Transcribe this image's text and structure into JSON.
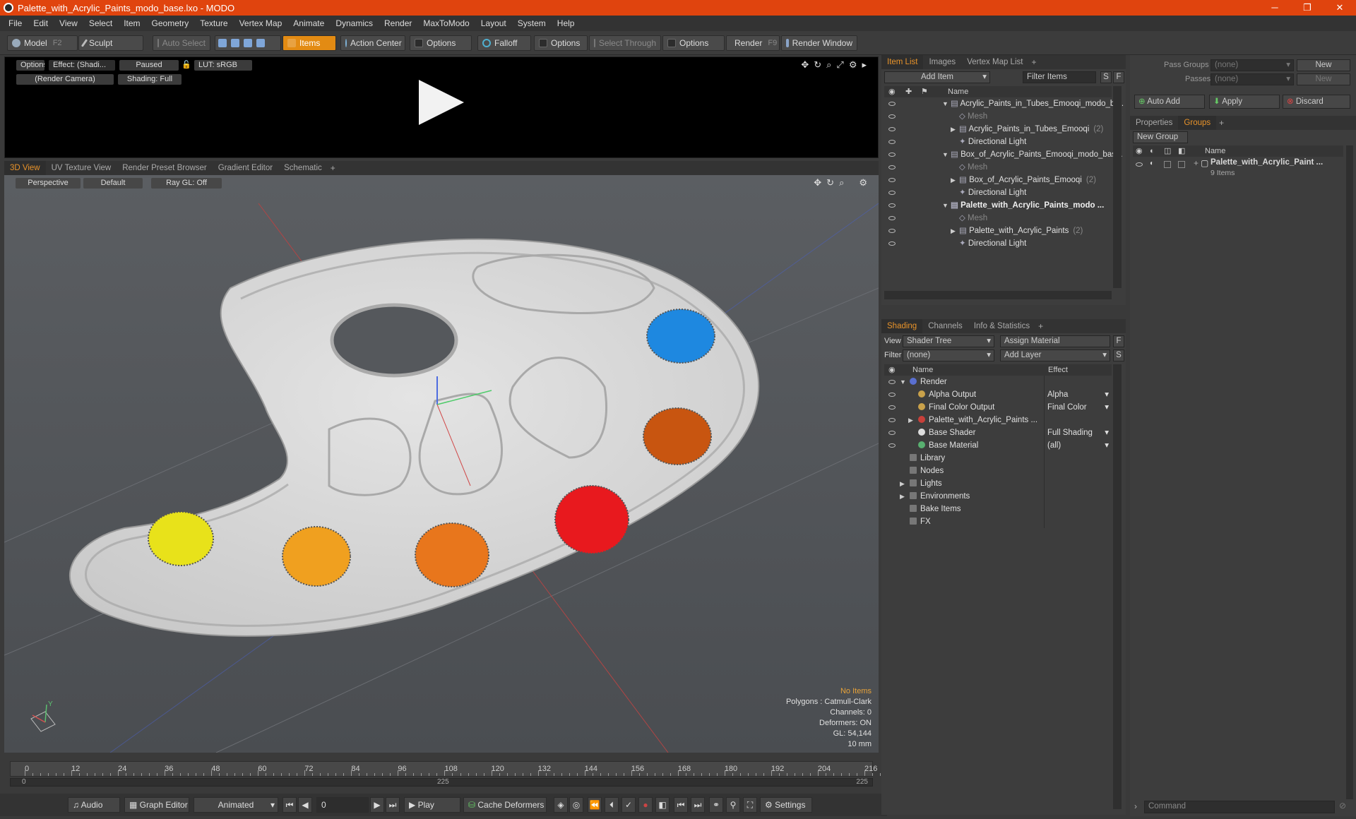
{
  "window": {
    "title": "Palette_with_Acrylic_Paints_modo_base.lxo - MODO",
    "minimize": "─",
    "maximize": "❐",
    "close": "✕"
  },
  "menu": [
    "File",
    "Edit",
    "View",
    "Select",
    "Item",
    "Geometry",
    "Texture",
    "Vertex Map",
    "Animate",
    "Dynamics",
    "Render",
    "MaxToModo",
    "Layout",
    "System",
    "Help"
  ],
  "toolbar": {
    "model": "Model",
    "model_key": "F2",
    "sculpt": "Sculpt",
    "auto_select": "Auto Select",
    "items": "Items",
    "action_center": "Action Center",
    "options1": "Options",
    "falloff": "Falloff",
    "options2": "Options",
    "select_through": "Select Through",
    "options3": "Options",
    "render": "Render",
    "render_key": "F9",
    "render_window": "Render Window"
  },
  "preview": {
    "options": "Options",
    "effect": "Effect: (Shadi...",
    "paused": "Paused",
    "lut": "LUT: sRGB",
    "camera": "(Render Camera)",
    "shading": "Shading: Full"
  },
  "view_tabs": [
    "3D View",
    "UV Texture View",
    "Render Preset Browser",
    "Gradient Editor",
    "Schematic"
  ],
  "view3d": {
    "projection": "Perspective",
    "style": "Default",
    "raygl": "Ray GL: Off",
    "axis_y": "Y",
    "stats": {
      "selection": "No Items",
      "polygons": "Polygons : Catmull-Clark",
      "channels": "Channels: 0",
      "deformers": "Deformers: ON",
      "gl": "GL: 54,144",
      "unit": "10 mm"
    }
  },
  "timeline": {
    "ticks": [
      "0",
      "12",
      "24",
      "36",
      "48",
      "60",
      "72",
      "84",
      "96",
      "108",
      "120",
      "132",
      "144",
      "156",
      "168",
      "180",
      "192",
      "204",
      "216"
    ],
    "lower_left": "0",
    "lower_mid": "225",
    "lower_right": "225"
  },
  "bottombar": {
    "audio": "Audio",
    "graph_editor": "Graph Editor",
    "animated": "Animated",
    "frame": "0",
    "play": "Play",
    "cache_deformers": "Cache Deformers",
    "settings": "Settings"
  },
  "item_list": {
    "tabs": [
      "Item List",
      "Images",
      "Vertex Map List"
    ],
    "add_item": "Add Item",
    "filter_items": "Filter Items",
    "s_btn": "S",
    "f_btn": "F",
    "col_name": "Name",
    "rows": [
      {
        "label": "Acrylic_Paints_in_Tubes_Emooqi_modo_b ...",
        "indent": 0,
        "expand": "▼",
        "style": ""
      },
      {
        "label": "Mesh",
        "indent": 1,
        "expand": "",
        "style": "dim"
      },
      {
        "label": "Acrylic_Paints_in_Tubes_Emooqi",
        "count": "(2)",
        "indent": 1,
        "expand": "▶",
        "style": ""
      },
      {
        "label": "Directional Light",
        "indent": 1,
        "expand": "",
        "style": ""
      },
      {
        "label": "Box_of_Acrylic_Paints_Emooqi_modo_bas...",
        "indent": 0,
        "expand": "▼",
        "style": ""
      },
      {
        "label": "Mesh",
        "indent": 1,
        "expand": "",
        "style": "dim"
      },
      {
        "label": "Box_of_Acrylic_Paints_Emooqi",
        "count": "(2)",
        "indent": 1,
        "expand": "▶",
        "style": ""
      },
      {
        "label": "Directional Light",
        "indent": 1,
        "expand": "",
        "style": ""
      },
      {
        "label": "Palette_with_Acrylic_Paints_modo ...",
        "indent": 0,
        "expand": "▼",
        "style": "bold"
      },
      {
        "label": "Mesh",
        "indent": 1,
        "expand": "",
        "style": "dim"
      },
      {
        "label": "Palette_with_Acrylic_Paints",
        "count": "(2)",
        "indent": 1,
        "expand": "▶",
        "style": ""
      },
      {
        "label": "Directional Light",
        "indent": 1,
        "expand": "",
        "style": ""
      }
    ]
  },
  "shading": {
    "tabs": [
      "Shading",
      "Channels",
      "Info & Statistics"
    ],
    "view_label": "View",
    "view_value": "Shader Tree",
    "assign_material": "Assign Material",
    "f_btn": "F",
    "filter_label": "Filter",
    "filter_value": "(none)",
    "add_layer": "Add Layer",
    "s_btn": "S",
    "col_name": "Name",
    "col_effect": "Effect",
    "rows": [
      {
        "label": "Render",
        "effect": "",
        "indent": 0,
        "expand": "▼",
        "ico": "#5a6fd0"
      },
      {
        "label": "Alpha Output",
        "effect": "Alpha",
        "indent": 1,
        "expand": "",
        "ico": "#c9a14a"
      },
      {
        "label": "Final Color Output",
        "effect": "Final Color",
        "indent": 1,
        "expand": "",
        "ico": "#c9a14a"
      },
      {
        "label": "Palette_with_Acrylic_Paints ...",
        "effect": "",
        "indent": 1,
        "expand": "▶",
        "ico": "#c8403a"
      },
      {
        "label": "Base Shader",
        "effect": "Full Shading",
        "indent": 1,
        "expand": "",
        "ico": "#dddddd"
      },
      {
        "label": "Base Material",
        "effect": "(all)",
        "indent": 1,
        "expand": "",
        "ico": "#58b070"
      },
      {
        "label": "Library",
        "effect": "",
        "indent": 0,
        "expand": "",
        "ico": ""
      },
      {
        "label": "Nodes",
        "effect": "",
        "indent": 0,
        "expand": "",
        "ico": ""
      },
      {
        "label": "Lights",
        "effect": "",
        "indent": 0,
        "expand": "▶",
        "ico": ""
      },
      {
        "label": "Environments",
        "effect": "",
        "indent": 0,
        "expand": "▶",
        "ico": ""
      },
      {
        "label": "Bake Items",
        "effect": "",
        "indent": 0,
        "expand": "",
        "ico": ""
      },
      {
        "label": "FX",
        "effect": "",
        "indent": 0,
        "expand": "",
        "ico": ""
      }
    ]
  },
  "groups": {
    "pass_groups_label": "Pass Groups",
    "pass_groups_value": "(none)",
    "new1": "New",
    "passes_label": "Passes",
    "passes_value": "(none)",
    "new2": "New",
    "auto_add": "Auto Add",
    "apply": "Apply",
    "discard": "Discard",
    "tabs": [
      "Properties",
      "Groups"
    ],
    "new_group": "New Group",
    "col_name": "Name",
    "group_name": "Palette_with_Acrylic_Paint ...",
    "group_count": "9 Items",
    "command_placeholder": "Command"
  },
  "colors": {
    "accent": "#e38b13",
    "title": "#e0440e",
    "paint_yellow": "#e8e21a",
    "paint_orange_light": "#f0a01f",
    "paint_orange": "#e8761c",
    "paint_red": "#e8191e",
    "paint_burnt": "#c85510",
    "paint_blue": "#1e88e0"
  }
}
